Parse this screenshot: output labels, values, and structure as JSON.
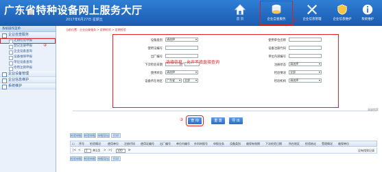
{
  "header": {
    "title": "广东省特种设备网上服务大厅",
    "date": "2017年6月27日 星期五",
    "nav": [
      {
        "label": "首 页",
        "icon": "home-icon"
      },
      {
        "label": "企业自查服务",
        "icon": "database-icon"
      },
      {
        "label": "企业信息管理",
        "icon": "tools-icon"
      },
      {
        "label": "企业信息维护",
        "icon": "shield-icon"
      },
      {
        "label": "系统维护",
        "icon": "info-icon"
      }
    ],
    "markers": {
      "m1": "①",
      "m2": "②",
      "m3": "③"
    }
  },
  "sidebar": {
    "title": "系统操作菜单",
    "groups": [
      {
        "label": "企业自查服务",
        "items": [
          "定期检验申报",
          "登记注册申报",
          "企业设备查询",
          "设备维保申报",
          "单位设备查询",
          "停用注销申报"
        ]
      },
      {
        "label": "企业设备管理",
        "items": []
      },
      {
        "label": "企业信息维护",
        "items": []
      },
      {
        "label": "系统维护",
        "items": []
      }
    ]
  },
  "content": {
    "breadcrumb": "当前位置：企业自查服务 > 定期检验 > 定期检验",
    "form": {
      "left": [
        {
          "label": "设备类别",
          "value": "请选择"
        },
        {
          "label": "使用证编号",
          "value": ""
        },
        {
          "label": "出厂编号",
          "value": ""
        },
        {
          "label": "下次检验日期",
          "value": ""
        },
        {
          "label": "使用状态",
          "value": "请选择"
        },
        {
          "label": "设备所在地区",
          "value": "广东省",
          "value2": "全部"
        }
      ],
      "right": [
        {
          "label": "使用单位名称",
          "value": ""
        },
        {
          "label": "设备注册代码",
          "value": ""
        },
        {
          "label": "单位内部编号",
          "value": ""
        },
        {
          "label": "注册状态",
          "value": "请选择"
        },
        {
          "label": "检验情况",
          "value": "全部"
        },
        {
          "label": "检验机构",
          "value": "请选择"
        }
      ],
      "date_sep": "至",
      "hint": "选填信息，允许不填直接查询"
    },
    "more": "高级搜索",
    "buttons": [
      "查 询",
      "重 置",
      "导 出"
    ],
    "toolbar_top": [
      "检验申报",
      "检验申报",
      "申报导出",
      "打印"
    ],
    "toolbar_bottom": [
      "检验申报",
      "检验申报",
      "申报导出",
      "打印"
    ],
    "columns": [
      "序号",
      "检验情况",
      "使用单位",
      "注册代码",
      "使用证编号",
      "出厂编号",
      "单位内编号",
      "外科申报号",
      "申报业务",
      "设备类别",
      "维保有效期",
      "下次检验日期",
      "所在地区",
      "检验结论",
      "受理情况",
      "维保单位"
    ],
    "pager": {
      "page": "1",
      "of": "共1页",
      "size": "100",
      "summary": "没有找到记录"
    }
  }
}
